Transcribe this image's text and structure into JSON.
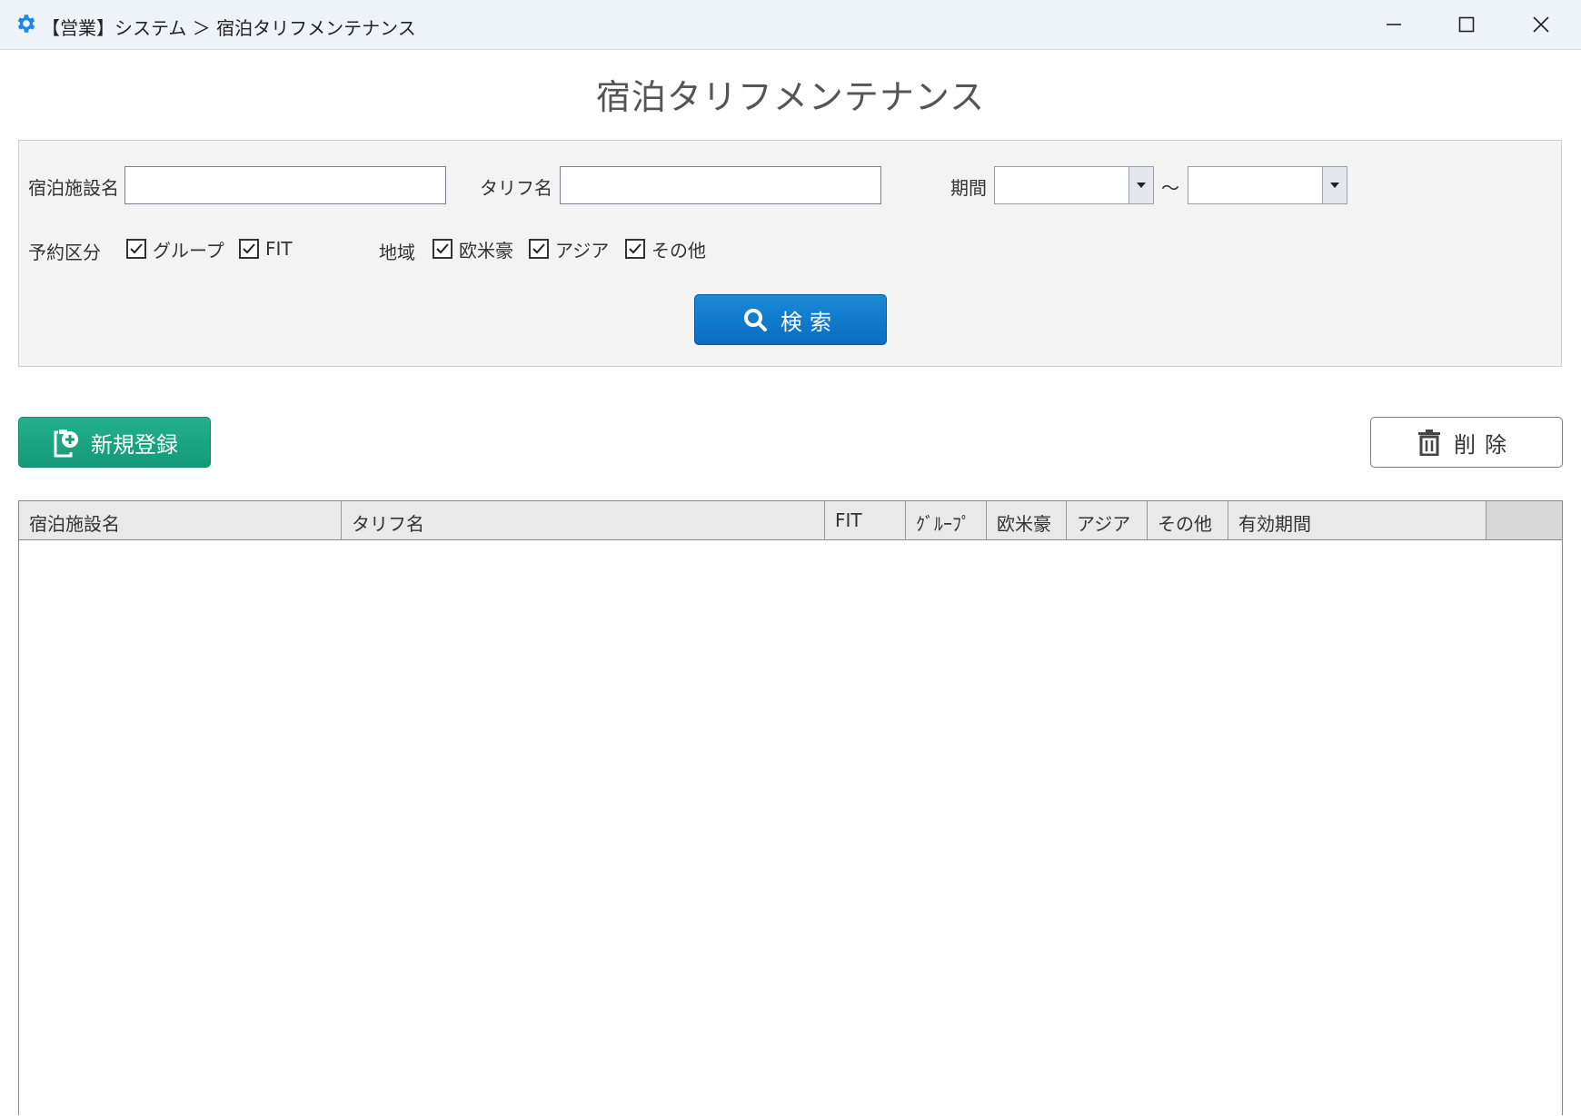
{
  "window": {
    "title": "【営業】システム ＞ 宿泊タリフメンテナンス",
    "controls": [
      "minimize",
      "maximize",
      "close"
    ]
  },
  "page": {
    "title": "宿泊タリフメンテナンス"
  },
  "search": {
    "facility_label": "宿泊施設名",
    "facility_value": "",
    "tariff_label": "タリフ名",
    "tariff_value": "",
    "period_label": "期間",
    "period_from": "",
    "period_to": "",
    "period_separator": "～",
    "reservation_label": "予約区分",
    "reservation_options": [
      {
        "label": "グループ",
        "checked": true
      },
      {
        "label": "FIT",
        "checked": true
      }
    ],
    "region_label": "地域",
    "region_options": [
      {
        "label": "欧米豪",
        "checked": true
      },
      {
        "label": "アジア",
        "checked": true
      },
      {
        "label": "その他",
        "checked": true
      }
    ],
    "search_button": "検索"
  },
  "toolbar": {
    "new_button": "新規登録",
    "delete_button": "削除"
  },
  "grid": {
    "columns": [
      "宿泊施設名",
      "タリフ名",
      "FIT",
      "ｸﾞﾙｰﾌﾟ",
      "欧米豪",
      "アジア",
      "その他",
      "有効期間"
    ],
    "rows": []
  },
  "colors": {
    "search_button": "#0a6cc2",
    "new_button": "#149977",
    "titlebar": "#eef3f8",
    "app_icon": "#1e88e5"
  }
}
